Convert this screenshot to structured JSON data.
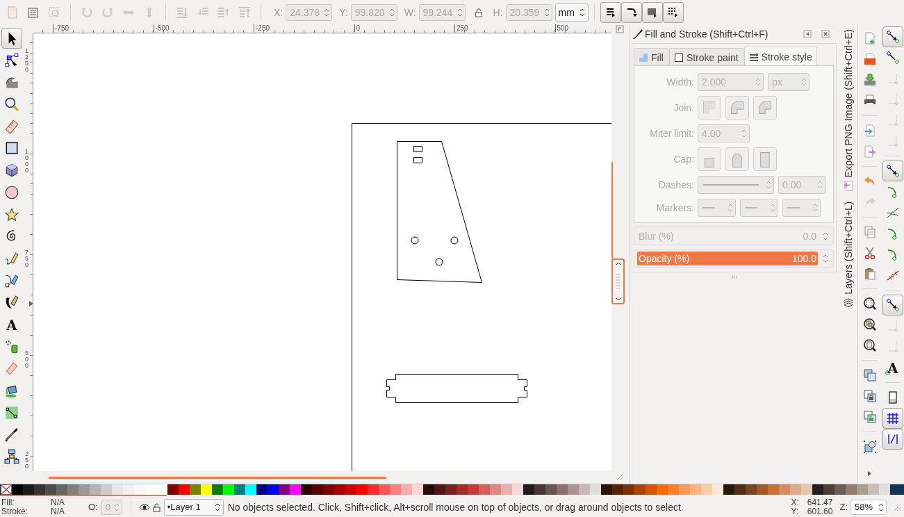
{
  "toolbar": {
    "fields": [
      {
        "label": "X:",
        "value": "24.378",
        "disabled": true
      },
      {
        "label": "Y:",
        "value": "99.820",
        "disabled": true
      },
      {
        "label": "W:",
        "value": "99.244",
        "disabled": true
      },
      {
        "label": "H:",
        "value": "20.359",
        "disabled": true
      }
    ],
    "unit": "mm",
    "affect": [
      {
        "on": true
      },
      {
        "on": true
      },
      {
        "on": true
      },
      {
        "on": true
      }
    ]
  },
  "rulers": {
    "horizontal": [
      "-750",
      "-500",
      "-250",
      "0",
      "250",
      "500"
    ],
    "vertical": [
      "1250",
      "1000",
      "750",
      "500",
      "250"
    ]
  },
  "tools": [
    {
      "kind": "selector",
      "selected": true
    },
    {
      "kind": "node",
      "selected": false
    },
    {
      "kind": "tweak",
      "selected": false
    },
    {
      "kind": "zoom",
      "selected": false
    },
    {
      "kind": "measure",
      "selected": false
    },
    {
      "kind": "rect",
      "selected": false
    },
    {
      "kind": "box3d",
      "selected": false
    },
    {
      "kind": "ellipse",
      "selected": false
    },
    {
      "kind": "star",
      "selected": false
    },
    {
      "kind": "spiral",
      "selected": false
    },
    {
      "kind": "pencil",
      "selected": false
    },
    {
      "kind": "pen",
      "selected": false
    },
    {
      "kind": "calligraphy",
      "selected": false
    },
    {
      "kind": "text",
      "glyph": "A",
      "selected": false
    },
    {
      "kind": "spray",
      "selected": false
    },
    {
      "kind": "eraser",
      "selected": false
    },
    {
      "kind": "bucket",
      "selected": false
    },
    {
      "kind": "gradient",
      "selected": false
    },
    {
      "kind": "dropper",
      "selected": false
    },
    {
      "kind": "connector",
      "selected": false
    }
  ],
  "dialog": {
    "title": "Fill and Stroke (Shift+Ctrl+F)",
    "tabs": [
      {
        "kind": "fill",
        "label": "Fill",
        "selected": false
      },
      {
        "kind": "paint",
        "label": "Stroke paint",
        "selected": false
      },
      {
        "kind": "style",
        "label": "Stroke style",
        "selected": true
      }
    ],
    "disabled": true,
    "width": {
      "label": "Width:",
      "value": "2.000",
      "unit": "px"
    },
    "join": {
      "label": "Join:"
    },
    "miter": {
      "label": "Miter limit:",
      "value": "4.00"
    },
    "cap": {
      "label": "Cap:"
    },
    "dashes": {
      "label": "Dashes:",
      "value": "0.00"
    },
    "markers": {
      "label": "Markers:"
    },
    "blur": {
      "label": "Blur (%)",
      "value": "0.0",
      "level": 0,
      "disabled": true
    },
    "opacity": {
      "label": "Opacity (%)",
      "value": "100.0",
      "level": 1,
      "disabled": false
    }
  },
  "dock_tabs": [
    {
      "label": "Export PNG Image (Shift+Ctrl+E)",
      "kind": "export"
    },
    {
      "label": "Layers (Shift+Ctrl+L)",
      "kind": "layers"
    }
  ],
  "commands": [
    [
      {
        "kind": "new",
        "disabled": false
      },
      {
        "kind": "open",
        "disabled": false
      },
      {
        "kind": "save",
        "disabled": false
      },
      {
        "kind": "print",
        "disabled": false
      }
    ],
    [
      {
        "kind": "import",
        "disabled": false
      },
      {
        "kind": "export",
        "disabled": false
      }
    ],
    [
      {
        "kind": "undo",
        "disabled": false
      },
      {
        "kind": "redo",
        "disabled": true
      }
    ],
    [
      {
        "kind": "copy",
        "disabled": false
      },
      {
        "kind": "cut",
        "disabled": false
      },
      {
        "kind": "paste",
        "disabled": false
      }
    ],
    [
      {
        "kind": "zoom-selection",
        "disabled": false
      },
      {
        "kind": "zoom-drawing",
        "disabled": false
      },
      {
        "kind": "zoom-page",
        "disabled": false
      }
    ],
    [
      {
        "kind": "duplicate",
        "disabled": false
      },
      {
        "kind": "clone",
        "disabled": false
      },
      {
        "kind": "unlink",
        "disabled": false
      }
    ],
    [
      {
        "kind": "group",
        "disabled": false
      }
    ]
  ],
  "snap": [
    [
      {
        "kind": "toggle",
        "on": true
      },
      {
        "kind": "toggle-small",
        "on": false
      },
      {
        "kind": "corner",
        "on": false
      },
      {
        "kind": "corner",
        "on": false
      },
      {
        "kind": "corner",
        "on": false
      },
      {
        "kind": "corner",
        "on": false
      }
    ],
    [
      {
        "kind": "toggle",
        "on": true
      },
      {
        "kind": "curve",
        "on": false
      },
      {
        "kind": "intersection",
        "on": false
      },
      {
        "kind": "curve",
        "on": false
      },
      {
        "kind": "curve",
        "on": false
      },
      {
        "kind": "midpoint",
        "on": false
      }
    ],
    [
      {
        "kind": "toggle",
        "on": true
      },
      {
        "kind": "corner",
        "on": false
      },
      {
        "kind": "corner",
        "on": false
      },
      {
        "kind": "text",
        "glyph": "A",
        "on": false
      }
    ],
    [
      {
        "kind": "page",
        "on": false
      },
      {
        "kind": "grid",
        "on": true
      },
      {
        "kind": "guide",
        "on": true
      }
    ]
  ],
  "palette": [
    {
      "color": "#000000"
    },
    {
      "color": "#1a1a1a"
    },
    {
      "color": "#333333"
    },
    {
      "color": "#4d4d4d"
    },
    {
      "color": "#666666"
    },
    {
      "color": "#808080"
    },
    {
      "color": "#999999"
    },
    {
      "color": "#b3b3b3"
    },
    {
      "color": "#cccccc"
    },
    {
      "color": "#e6e6e6"
    },
    {
      "color": "#f2f2f2"
    },
    {
      "color": "#f8f8f8"
    },
    {
      "color": "#fcfcfc"
    },
    {
      "color": "#ffffff"
    },
    {
      "color": "#800000"
    },
    {
      "color": "#ff0000"
    },
    {
      "color": "#808000"
    },
    {
      "color": "#ffff00"
    },
    {
      "color": "#008000"
    },
    {
      "color": "#00ff00"
    },
    {
      "color": "#008080"
    },
    {
      "color": "#00ffff"
    },
    {
      "color": "#000080"
    },
    {
      "color": "#0000ff"
    },
    {
      "color": "#800080"
    },
    {
      "color": "#ff00ff"
    },
    {
      "color": "#2b0000"
    },
    {
      "color": "#550000"
    },
    {
      "color": "#800001"
    },
    {
      "color": "#aa0000"
    },
    {
      "color": "#d40000"
    },
    {
      "color": "#ff0001"
    },
    {
      "color": "#ff2a2a"
    },
    {
      "color": "#ff5555"
    },
    {
      "color": "#ff8080"
    },
    {
      "color": "#ffaaaa"
    },
    {
      "color": "#ffd5d5"
    },
    {
      "color": "#280b0b"
    },
    {
      "color": "#501616"
    },
    {
      "color": "#782121"
    },
    {
      "color": "#a02c2c"
    },
    {
      "color": "#c83737"
    },
    {
      "color": "#d35f5f"
    },
    {
      "color": "#de8787"
    },
    {
      "color": "#e9afaf"
    },
    {
      "color": "#f4d7d7"
    },
    {
      "color": "#241c1c"
    },
    {
      "color": "#483737"
    },
    {
      "color": "#6c5353"
    },
    {
      "color": "#916f6f"
    },
    {
      "color": "#ac9393"
    },
    {
      "color": "#c8b7b7"
    },
    {
      "color": "#e3dbdb"
    },
    {
      "color": "#2b1100"
    },
    {
      "color": "#552200"
    },
    {
      "color": "#803300"
    },
    {
      "color": "#aa4400"
    },
    {
      "color": "#d45500"
    },
    {
      "color": "#ff6600"
    },
    {
      "color": "#ff7f2a"
    },
    {
      "color": "#ff9955"
    },
    {
      "color": "#ffb380"
    },
    {
      "color": "#ffccaa"
    },
    {
      "color": "#ffe6d5"
    },
    {
      "color": "#28170b"
    },
    {
      "color": "#502d16"
    },
    {
      "color": "#784421"
    },
    {
      "color": "#a05a2c"
    },
    {
      "color": "#c87137"
    },
    {
      "color": "#d38d5f"
    },
    {
      "color": "#deaa87"
    },
    {
      "color": "#e9c6af"
    },
    {
      "color": "#241f1c"
    },
    {
      "color": "#483e37"
    },
    {
      "color": "#6c5d53"
    },
    {
      "color": "#917c6f"
    },
    {
      "color": "#ac9d93"
    },
    {
      "color": "#c8beb7"
    },
    {
      "color": "#e3dedb"
    }
  ],
  "status": {
    "fill_label": "Fill:",
    "fill_value": "N/A",
    "stroke_label": "Stroke:",
    "stroke_value": "N/A",
    "opacity_label": "O:",
    "opacity_value": "0",
    "opacity_disabled": true,
    "layer": "•Layer 1",
    "message": "No objects selected. Click, Shift+click, Alt+scroll mouse on top of objects, or drag around objects to select.",
    "x_label": "X:",
    "x_value": "641.47",
    "y_label": "Y:",
    "y_value": "601.60",
    "zoom_label": "Z:",
    "zoom_value": "58%"
  }
}
